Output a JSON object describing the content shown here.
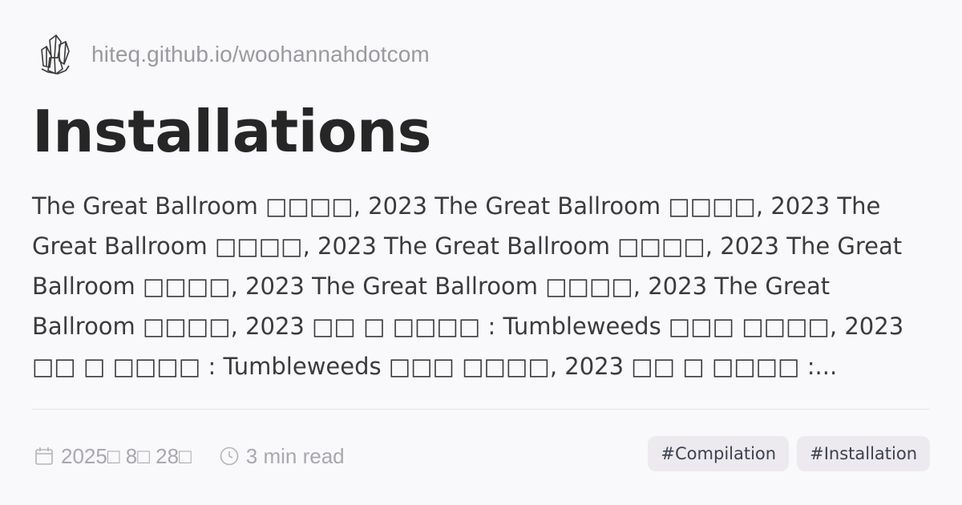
{
  "site": {
    "url": "hiteq.github.io/woohannahdotcom",
    "logo_icon": "crystal-cluster-icon"
  },
  "post": {
    "title": "Installations",
    "excerpt": "The Great Ballroom □□□□, 2023 The Great Ballroom □□□□, 2023 The Great Ballroom □□□□, 2023 The Great Ballroom □□□□, 2023 The Great Ballroom □□□□, 2023 The Great Ballroom □□□□, 2023 The Great Ballroom □□□□, 2023 □□ □ □□□□ : Tumbleweeds □□□ □□□□, 2023 □□ □ □□□□ : Tumbleweeds □□□ □□□□, 2023 □□ □ □□□□ :...",
    "date": "2025□ 8□ 28□",
    "read_time": "3 min read",
    "tags": [
      "#Compilation",
      "#Installation"
    ]
  },
  "icons": {
    "date": "calendar-icon",
    "read_time": "clock-icon"
  },
  "colors": {
    "background": "#f9f8fa",
    "title": "#262626",
    "muted": "#a8a8ae",
    "tag_bg": "#eceaee"
  }
}
